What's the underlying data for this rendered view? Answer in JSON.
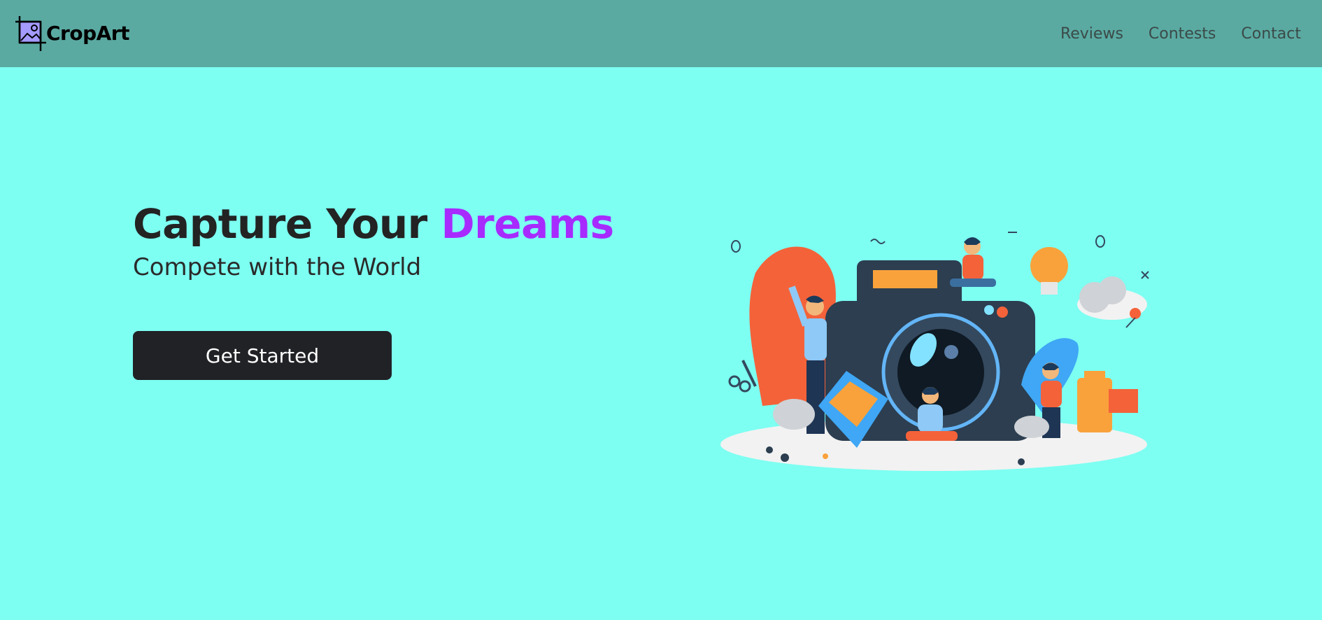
{
  "brand": {
    "name": "CropArt",
    "logo_icon": "crop-picture-icon"
  },
  "nav": {
    "links": [
      {
        "label": "Reviews"
      },
      {
        "label": "Contests"
      },
      {
        "label": "Contact"
      }
    ]
  },
  "hero": {
    "title_main": "Capture Your ",
    "title_accent": "Dreams",
    "subtitle": "Compete with the World",
    "cta_label": "Get Started",
    "illustration_icon": "camera-people-illustration"
  },
  "colors": {
    "page_bg": "#7dfff2",
    "navbar_bg": "#5aaaa2",
    "accent": "#a72bff",
    "button_bg": "#212226"
  }
}
